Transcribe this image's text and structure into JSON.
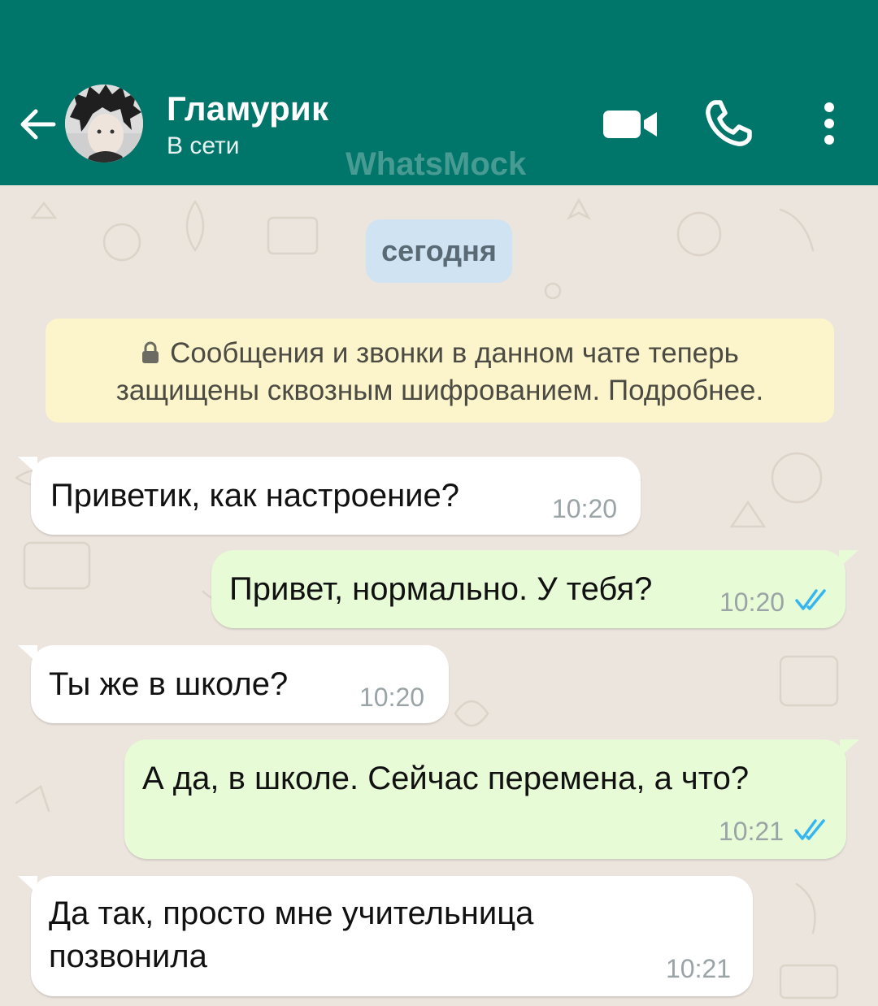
{
  "header": {
    "title": "Гламурик",
    "status": "В сети",
    "watermark": "WhatsMock",
    "back_icon": "arrow-left-icon",
    "video_icon": "video-camera-icon",
    "call_icon": "phone-icon",
    "menu_icon": "more-vertical-icon"
  },
  "chat": {
    "date_label": "сегодня",
    "system_message": {
      "line1": "Сообщения и звонки в данном чате теперь",
      "line2": "защищены сквозным шифрованием. Подробнее."
    },
    "messages": [
      {
        "direction": "incoming",
        "text": "Приветик, как настроение?",
        "time": "10:20"
      },
      {
        "direction": "outgoing",
        "text": "Привет, нормально. У тебя?",
        "time": "10:20",
        "status": "read"
      },
      {
        "direction": "incoming",
        "text": "Ты же в школе?",
        "time": "10:20"
      },
      {
        "direction": "outgoing",
        "text": "А да, в школе. Сейчас перемена, а что?",
        "time": "10:21",
        "status": "read"
      },
      {
        "direction": "incoming",
        "text_line1": "Да так, просто мне учительница",
        "text_line2": "позвонила",
        "time": "10:21"
      }
    ]
  },
  "colors": {
    "header": "#00756a",
    "chat_background": "#ece5dd",
    "incoming_bubble": "#ffffff",
    "outgoing_bubble": "#e7fbd6",
    "date_pill": "#cfe3f2",
    "system_bubble": "#fcf4cb",
    "read_ticks": "#34b7f1"
  }
}
